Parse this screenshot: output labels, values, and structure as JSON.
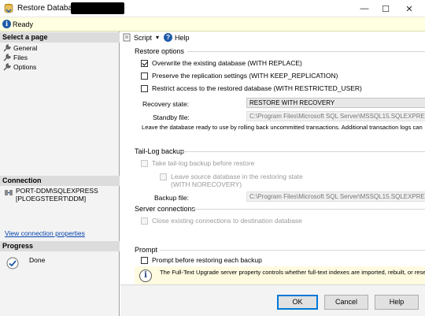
{
  "window": {
    "title": "Restore Database -",
    "minimize_glyph": "—",
    "maximize_glyph": "☐",
    "close_glyph": "✕"
  },
  "status": {
    "text": "Ready"
  },
  "left_pane": {
    "select_page_header": "Select a page",
    "pages": [
      {
        "label": "General"
      },
      {
        "label": "Files"
      },
      {
        "label": "Options"
      }
    ],
    "connection_header": "Connection",
    "connection_server": "PORT-DDM\\SQLEXPRESS",
    "connection_user": "[PLOEGSTEERT\\DDM]",
    "connection_link": "View connection properties",
    "progress_header": "Progress",
    "progress_text": "Done"
  },
  "toolbar": {
    "script_label": "Script",
    "script_dropdown_glyph": "▾",
    "help_label": "Help"
  },
  "restore_options": {
    "title": "Restore options",
    "overwrite": {
      "label": "Overwrite the existing database (WITH REPLACE)",
      "checked": true
    },
    "preserve": {
      "label": "Preserve the replication settings (WITH KEEP_REPLICATION)",
      "checked": false
    },
    "restrict": {
      "label": "Restrict access to the restored database (WITH RESTRICTED_USER)",
      "checked": false
    },
    "recovery_state_label": "Recovery state:",
    "recovery_state_value": "RESTORE WITH RECOVERY",
    "standby_file_label": "Standby file:",
    "standby_file_value": "C:\\Program Files\\Microsoft SQL Server\\MSSQL15.SQLEXPRESS\\",
    "description": "Leave the database ready to use by rolling back uncommitted transactions. Additional transaction logs can"
  },
  "tail_log": {
    "title": "Tail-Log backup",
    "take_backup": {
      "label": "Take tail-log backup before restore",
      "checked": false
    },
    "leave_source_line1": "Leave source database in the restoring state",
    "leave_source_line2": "(WITH NORECOVERY)",
    "backup_file_label": "Backup file:",
    "backup_file_value": "C:\\Program Files\\Microsoft SQL Server\\MSSQL15.SQLEXPRESS\\"
  },
  "server_connections": {
    "title": "Server connections",
    "close_existing": {
      "label": "Close existing connections to destination database",
      "checked": false
    }
  },
  "prompt": {
    "title": "Prompt",
    "prompt_before": {
      "label": "Prompt before restoring each backup",
      "checked": false
    },
    "info_glyph": "i",
    "info_text": "The Full-Text Upgrade server property controls whether full-text indexes are imported, rebuilt, or rese"
  },
  "buttons": {
    "ok": "OK",
    "cancel": "Cancel",
    "help": "Help"
  },
  "colors": {
    "accent": "#0078d7",
    "status_bar": "#ffffe1",
    "info_box": "#fffbe0",
    "pane_header": "#dcdcdc"
  },
  "icons": {
    "app": "database-restore-icon",
    "status": "info-icon",
    "page": "wrench-icon",
    "connection": "connection-icon",
    "progress": "progress-done-icon",
    "script": "script-icon",
    "help": "help-icon"
  }
}
